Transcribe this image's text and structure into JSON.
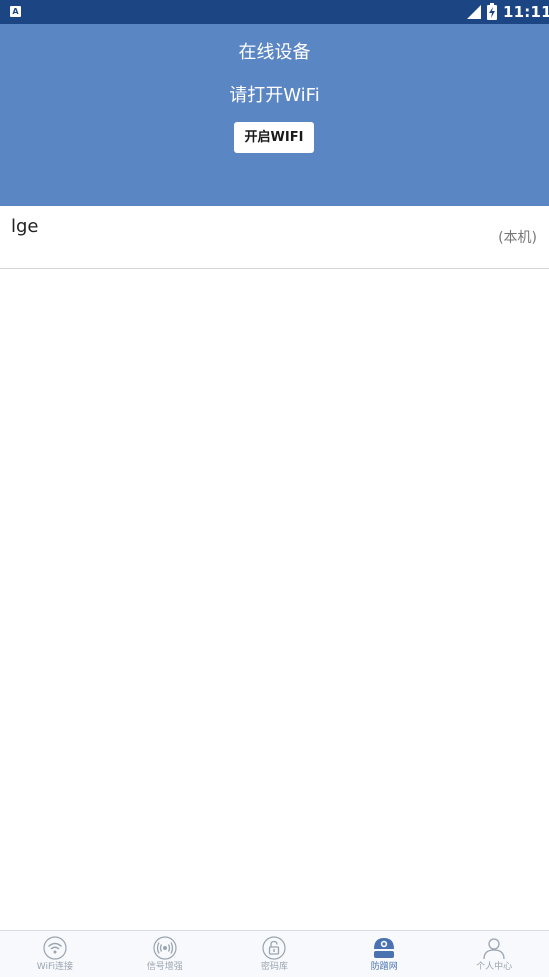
{
  "status_bar": {
    "left_badge": "A",
    "time": "11:11",
    "icons": [
      "notification-icon",
      "signal-icon",
      "battery-charging-icon"
    ]
  },
  "header": {
    "title": "在线设备",
    "wifi_prompt": "请打开WiFi",
    "open_wifi_label": "开启WIFI"
  },
  "devices": [
    {
      "name": "lge",
      "tag": "(本机)"
    }
  ],
  "bottom_nav": {
    "items": [
      {
        "label": "WiFi连接",
        "icon": "wifi-icon",
        "active": false
      },
      {
        "label": "信号增强",
        "icon": "signal-boost-icon",
        "active": false
      },
      {
        "label": "密码库",
        "icon": "lock-icon",
        "active": false
      },
      {
        "label": "防蹭网",
        "icon": "camera-shield-icon",
        "active": true
      },
      {
        "label": "个人中心",
        "icon": "person-icon",
        "active": false
      }
    ]
  },
  "colors": {
    "status_bar": "#1c4583",
    "header": "#5b86c4",
    "active_nav": "#4a72b0",
    "inactive_nav": "#9aa4b1"
  }
}
